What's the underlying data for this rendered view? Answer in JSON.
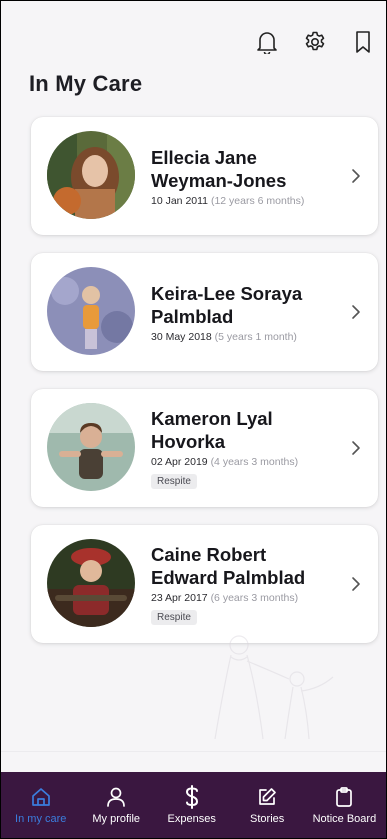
{
  "header": {
    "title": "In My Care",
    "icons": [
      "bell-icon",
      "gear-icon",
      "bookmark-icon"
    ]
  },
  "children": [
    {
      "name": "Ellecia Jane Weyman-Jones",
      "dob": "10 Jan 2011",
      "age": "(12 years 6 months)",
      "badge": null
    },
    {
      "name": "Keira-Lee Soraya Palmblad",
      "dob": "30 May 2018",
      "age": "(5 years 1 month)",
      "badge": null
    },
    {
      "name": "Kameron Lyal Hovorka",
      "dob": "02 Apr 2019",
      "age": "(4 years 3 months)",
      "badge": "Respite"
    },
    {
      "name": "Caine Robert Edward Palmblad",
      "dob": "23 Apr 2017",
      "age": "(6 years 3 months)",
      "badge": "Respite"
    }
  ],
  "nav": {
    "items": [
      {
        "label": "In my care",
        "icon": "home-icon",
        "active": true
      },
      {
        "label": "My profile",
        "icon": "person-icon",
        "active": false
      },
      {
        "label": "Expenses",
        "icon": "dollar-icon",
        "active": false
      },
      {
        "label": "Stories",
        "icon": "edit-icon",
        "active": false
      },
      {
        "label": "Notice Board",
        "icon": "clipboard-icon",
        "active": false
      }
    ]
  },
  "colors": {
    "nav_background": "#3a1740",
    "nav_active": "#3b7ddd",
    "page_background": "#f6f5f7"
  }
}
